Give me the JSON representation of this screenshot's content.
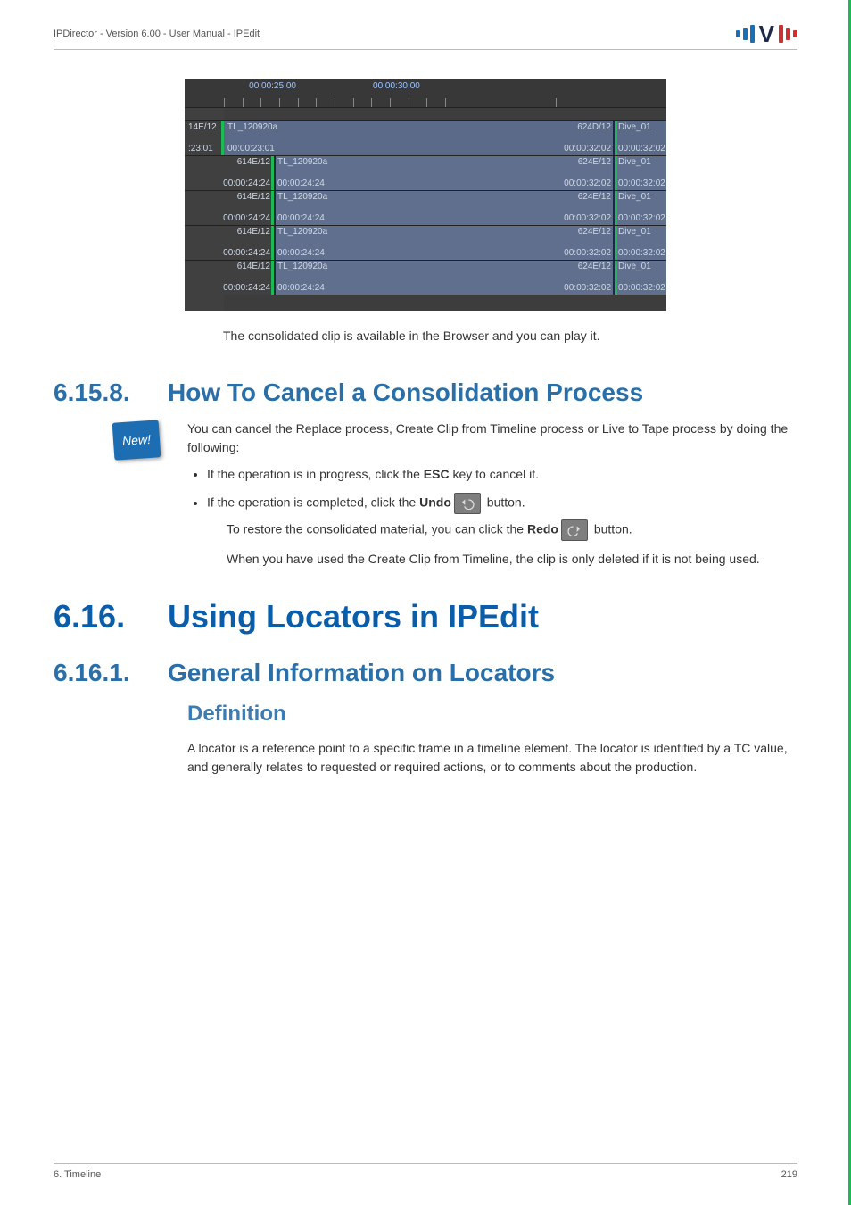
{
  "header": {
    "product_line": "IPDirector - Version 6.00 - User Manual - IPEdit"
  },
  "figure": {
    "ruler": {
      "t1": "00:00:25:00",
      "t2": "00:00:30:00"
    },
    "rows": {
      "r0": {
        "left_tc": "14E/12",
        "name": "TL_120920a",
        "tr": "624D/12",
        "right": "Dive_01",
        "bl": ":23:01",
        "bln": "00:00:23:01",
        "br": "00:00:32:02",
        "rbr": "00:00:32:02"
      },
      "r1": {
        "tl": "614E/12",
        "name": "TL_120920a",
        "tr": "624E/12",
        "right": "Dive_01",
        "bl": "00:00:24:24",
        "bln": "00:00:24:24",
        "br": "00:00:32:02",
        "rbr": "00:00:32:02"
      },
      "r2": {
        "tl": "614E/12",
        "name": "TL_120920a",
        "tr": "624E/12",
        "right": "Dive_01",
        "bl": "00:00:24:24",
        "bln": "00:00:24:24",
        "br": "00:00:32:02",
        "rbr": "00:00:32:02"
      },
      "r3": {
        "tl": "614E/12",
        "name": "TL_120920a",
        "tr": "624E/12",
        "right": "Dive_01",
        "bl": "00:00:24:24",
        "bln": "00:00:24:24",
        "br": "00:00:32:02",
        "rbr": "00:00:32:02"
      },
      "r4": {
        "tl": "614E/12",
        "name": "TL_120920a",
        "tr": "624E/12",
        "right": "Dive_01",
        "bl": "00:00:24:24",
        "bln": "00:00:24:24",
        "br": "00:00:32:02",
        "rbr": "00:00:32:02"
      }
    }
  },
  "caption": "The consolidated clip is available in the Browser and you can play it.",
  "sec6158": {
    "num": "6.15.8.",
    "title": "How To Cancel a Consolidation Process",
    "new_badge": "New!",
    "intro": "You can cancel the Replace process, Create Clip from Timeline process or Live to Tape process by doing the following:",
    "bullet1_a": "If the operation is in progress, click the ",
    "bullet1_esc": "ESC",
    "bullet1_b": " key to cancel it.",
    "bullet2_a": "If the operation is completed, click the ",
    "bullet2_undo": "Undo",
    "bullet2_b": " button.",
    "nested_a": "To restore the consolidated material, you can click the ",
    "nested_redo": "Redo",
    "nested_b": " button.",
    "nested2": "When you have used the Create Clip from Timeline, the clip is only deleted if it is not being used."
  },
  "sec616": {
    "num": "6.16.",
    "title": "Using Locators in IPEdit"
  },
  "sec6161": {
    "num": "6.16.1.",
    "title": "General Information on Locators",
    "def_heading": "Definition",
    "def_body": "A locator is a reference point to a specific frame in a timeline element. The locator is identified by a TC value, and generally relates to requested or required actions, or to comments about the production."
  },
  "footer": {
    "chapter": "6. Timeline",
    "page": "219"
  }
}
